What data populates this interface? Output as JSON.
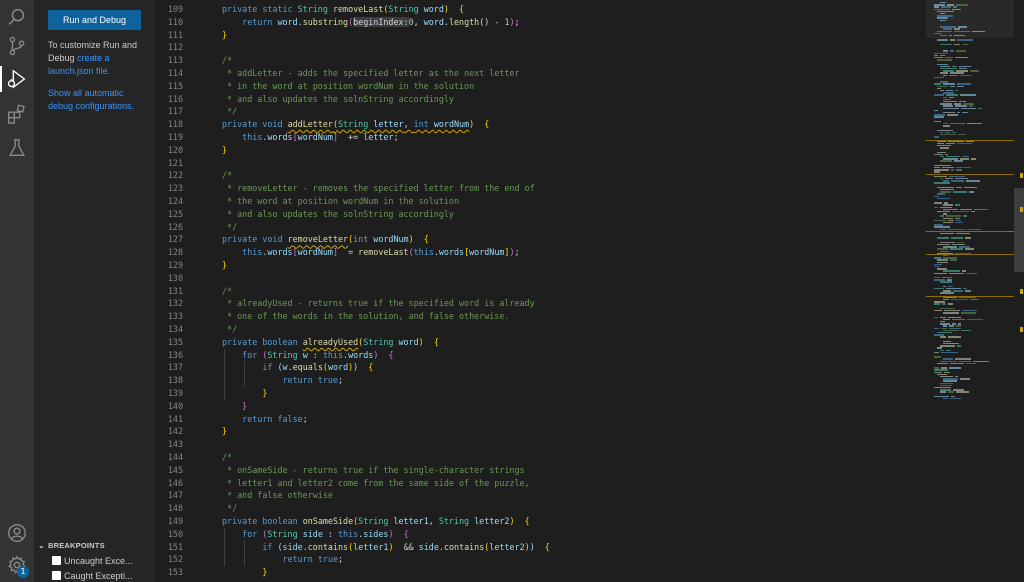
{
  "activity_bar": {
    "items": [
      {
        "icon": "search-icon"
      },
      {
        "icon": "source-control-icon"
      },
      {
        "icon": "run-debug-icon",
        "active": true
      },
      {
        "icon": "extensions-icon"
      },
      {
        "icon": "testing-icon"
      }
    ],
    "bottom": [
      {
        "icon": "account-icon"
      },
      {
        "icon": "settings-gear-icon",
        "badge": "1"
      }
    ]
  },
  "sidebar": {
    "run_button": "Run and Debug",
    "customize_text": "To customize Run and Debug ",
    "customize_link": "create a launch.json file.",
    "show_all_link": "Show all automatic debug configurations.",
    "breakpoints": {
      "title": "BREAKPOINTS",
      "items": [
        {
          "label": "Uncaught Exce..."
        },
        {
          "label": "Caught Excepti..."
        }
      ]
    }
  },
  "editor": {
    "line_numbers": [
      "109",
      "110",
      "111",
      "112",
      "113",
      "114",
      "115",
      "116",
      "117",
      "118",
      "119",
      "120",
      "121",
      "122",
      "123",
      "124",
      "125",
      "126",
      "127",
      "128",
      "129",
      "130",
      "131",
      "132",
      "133",
      "134",
      "135",
      "136",
      "137",
      "138",
      "139",
      "140",
      "141",
      "142",
      "143",
      "144",
      "145",
      "146",
      "147",
      "148",
      "149",
      "150",
      "151",
      "152",
      "153"
    ],
    "lines": [
      [
        [
          "kw",
          "private "
        ],
        [
          "kw",
          "static "
        ],
        [
          "ty",
          "String "
        ],
        [
          "fn",
          "removeLast"
        ],
        [
          "br",
          "("
        ],
        [
          "ty",
          "String "
        ],
        [
          "vr",
          "word"
        ],
        [
          "br",
          ")"
        ],
        [
          "",
          "  "
        ],
        [
          "br",
          "{"
        ]
      ],
      [
        [
          "",
          "    "
        ],
        [
          "kw",
          "return "
        ],
        [
          "vr",
          "word"
        ],
        [
          "",
          "."
        ],
        [
          "fn",
          "substring"
        ],
        [
          "bp",
          "("
        ],
        [
          "hl",
          "beginIndex:"
        ],
        [
          "nm",
          "0"
        ],
        [
          "",
          ", "
        ],
        [
          "vr",
          "word"
        ],
        [
          "",
          "."
        ],
        [
          "fn",
          "length"
        ],
        [
          "",
          "() - "
        ],
        [
          "nm",
          "1"
        ],
        [
          "bp",
          ")"
        ],
        [
          "",
          ";"
        ]
      ],
      [
        [
          "br",
          "}"
        ]
      ],
      [
        [
          "",
          ""
        ]
      ],
      [
        [
          "cm",
          "/*"
        ]
      ],
      [
        [
          "cm",
          " * addLetter - adds the specified letter as the next letter"
        ]
      ],
      [
        [
          "cm",
          " * in the word at position wordNum in the solution"
        ]
      ],
      [
        [
          "cm",
          " * and also updates the solnString accordingly"
        ]
      ],
      [
        [
          "cm",
          " */"
        ]
      ],
      [
        [
          "kw",
          "private "
        ],
        [
          "kw",
          "void "
        ],
        [
          "fn sq",
          "addLetter"
        ],
        [
          "br sq",
          "("
        ],
        [
          "ty sq",
          "String "
        ],
        [
          "vr sq",
          "letter"
        ],
        [
          "sq",
          ", "
        ],
        [
          "kw sq",
          "int "
        ],
        [
          "vr sq",
          "wordNum"
        ],
        [
          "br",
          ")"
        ],
        [
          "",
          "  "
        ],
        [
          "br",
          "{"
        ]
      ],
      [
        [
          "",
          "    "
        ],
        [
          "kw",
          "this"
        ],
        [
          "",
          "."
        ],
        [
          "vr",
          "words"
        ],
        [
          "bp",
          "["
        ],
        [
          "vr",
          "wordNum"
        ],
        [
          "bp",
          "]"
        ],
        [
          "",
          "  += "
        ],
        [
          "vr",
          "letter"
        ],
        [
          "",
          ";"
        ]
      ],
      [
        [
          "br",
          "}"
        ]
      ],
      [
        [
          "",
          ""
        ]
      ],
      [
        [
          "cm",
          "/*"
        ]
      ],
      [
        [
          "cm",
          " * removeLetter - removes the specified letter from the end of"
        ]
      ],
      [
        [
          "cm",
          " * the word at position wordNum in the solution"
        ]
      ],
      [
        [
          "cm",
          " * and also updates the solnString accordingly"
        ]
      ],
      [
        [
          "cm",
          " */"
        ]
      ],
      [
        [
          "kw",
          "private "
        ],
        [
          "kw",
          "void "
        ],
        [
          "fn sq",
          "removeLetter"
        ],
        [
          "br",
          "("
        ],
        [
          "kw",
          "int "
        ],
        [
          "vr",
          "wordNum"
        ],
        [
          "br",
          ")"
        ],
        [
          "",
          "  "
        ],
        [
          "br",
          "{"
        ]
      ],
      [
        [
          "",
          "    "
        ],
        [
          "kw",
          "this"
        ],
        [
          "",
          "."
        ],
        [
          "vr",
          "words"
        ],
        [
          "bp",
          "["
        ],
        [
          "vr",
          "wordNum"
        ],
        [
          "bp",
          "]"
        ],
        [
          "",
          "  = "
        ],
        [
          "fn",
          "removeLast"
        ],
        [
          "bp",
          "("
        ],
        [
          "kw",
          "this"
        ],
        [
          "",
          "."
        ],
        [
          "vr",
          "words"
        ],
        [
          "br",
          "["
        ],
        [
          "vr",
          "wordNum"
        ],
        [
          "br",
          "]"
        ],
        [
          "bp",
          ")"
        ],
        [
          "",
          ";"
        ]
      ],
      [
        [
          "br",
          "}"
        ]
      ],
      [
        [
          "",
          ""
        ]
      ],
      [
        [
          "cm",
          "/*"
        ]
      ],
      [
        [
          "cm",
          " * alreadyUsed - returns true if the specified word is already"
        ]
      ],
      [
        [
          "cm",
          " * one of the words in the solution, and false otherwise."
        ]
      ],
      [
        [
          "cm",
          " */"
        ]
      ],
      [
        [
          "kw",
          "private "
        ],
        [
          "kw",
          "boolean "
        ],
        [
          "fn sq",
          "alreadyUsed"
        ],
        [
          "br",
          "("
        ],
        [
          "ty",
          "String "
        ],
        [
          "vr",
          "word"
        ],
        [
          "br",
          ")"
        ],
        [
          "",
          "  "
        ],
        [
          "br",
          "{"
        ]
      ],
      [
        [
          "",
          "    "
        ],
        [
          "kw",
          "for "
        ],
        [
          "bp",
          "("
        ],
        [
          "ty",
          "String "
        ],
        [
          "vr",
          "w"
        ],
        [
          "",
          " : "
        ],
        [
          "kw",
          "this"
        ],
        [
          "",
          "."
        ],
        [
          "vr",
          "words"
        ],
        [
          "bp",
          ")"
        ],
        [
          "",
          "  "
        ],
        [
          "bp",
          "{"
        ]
      ],
      [
        [
          "",
          "        "
        ],
        [
          "kw",
          "if "
        ],
        [
          "vr",
          "("
        ],
        [
          "vr",
          "w"
        ],
        [
          "",
          "."
        ],
        [
          "fn",
          "equals"
        ],
        [
          "br",
          "("
        ],
        [
          "vr",
          "word"
        ],
        [
          "br",
          ")"
        ],
        [
          "vr",
          ")"
        ],
        [
          "",
          "  "
        ],
        [
          "br",
          "{"
        ]
      ],
      [
        [
          "",
          "            "
        ],
        [
          "kw",
          "return "
        ],
        [
          "kw",
          "true"
        ],
        [
          "",
          ";"
        ]
      ],
      [
        [
          "",
          "        "
        ],
        [
          "br",
          "}"
        ]
      ],
      [
        [
          "",
          "    "
        ],
        [
          "bp",
          "}"
        ]
      ],
      [
        [
          "",
          "    "
        ],
        [
          "kw",
          "return "
        ],
        [
          "kw",
          "false"
        ],
        [
          "",
          ";"
        ]
      ],
      [
        [
          "br",
          "}"
        ]
      ],
      [
        [
          "",
          ""
        ]
      ],
      [
        [
          "cm",
          "/*"
        ]
      ],
      [
        [
          "cm",
          " * onSameSide - returns true if the single-character strings"
        ]
      ],
      [
        [
          "cm",
          " * letter1 and letter2 come from the same side of the puzzle,"
        ]
      ],
      [
        [
          "cm",
          " * and false otherwise"
        ]
      ],
      [
        [
          "cm",
          " */"
        ]
      ],
      [
        [
          "kw",
          "private "
        ],
        [
          "kw",
          "boolean "
        ],
        [
          "fn",
          "onSameSide"
        ],
        [
          "br",
          "("
        ],
        [
          "ty",
          "String "
        ],
        [
          "vr",
          "letter1"
        ],
        [
          "",
          ", "
        ],
        [
          "ty",
          "String "
        ],
        [
          "vr",
          "letter2"
        ],
        [
          "br",
          ")"
        ],
        [
          "",
          "  "
        ],
        [
          "br",
          "{"
        ]
      ],
      [
        [
          "",
          "    "
        ],
        [
          "kw",
          "for "
        ],
        [
          "bp",
          "("
        ],
        [
          "ty",
          "String "
        ],
        [
          "vr",
          "side"
        ],
        [
          "",
          " : "
        ],
        [
          "kw",
          "this"
        ],
        [
          "",
          "."
        ],
        [
          "vr",
          "sides"
        ],
        [
          "bp",
          ")"
        ],
        [
          "",
          "  "
        ],
        [
          "bp",
          "{"
        ]
      ],
      [
        [
          "",
          "        "
        ],
        [
          "kw",
          "if "
        ],
        [
          "vr",
          "("
        ],
        [
          "vr",
          "side"
        ],
        [
          "",
          "."
        ],
        [
          "fn",
          "contains"
        ],
        [
          "br",
          "("
        ],
        [
          "vr",
          "letter1"
        ],
        [
          "br",
          ")"
        ],
        [
          "",
          "  && "
        ],
        [
          "vr",
          "side"
        ],
        [
          "",
          "."
        ],
        [
          "fn",
          "contains"
        ],
        [
          "br",
          "("
        ],
        [
          "vr",
          "letter2"
        ],
        [
          "br",
          ")"
        ],
        [
          "vr",
          ")"
        ],
        [
          "",
          "  "
        ],
        [
          "br",
          "{"
        ]
      ],
      [
        [
          "",
          "            "
        ],
        [
          "kw",
          "return "
        ],
        [
          "kw",
          "true"
        ],
        [
          "",
          ";"
        ]
      ],
      [
        [
          "",
          "        "
        ],
        [
          "br",
          "}"
        ]
      ]
    ]
  },
  "colors": {
    "accent": "#0e639c",
    "link": "#3794ff",
    "warning": "#cca700"
  }
}
